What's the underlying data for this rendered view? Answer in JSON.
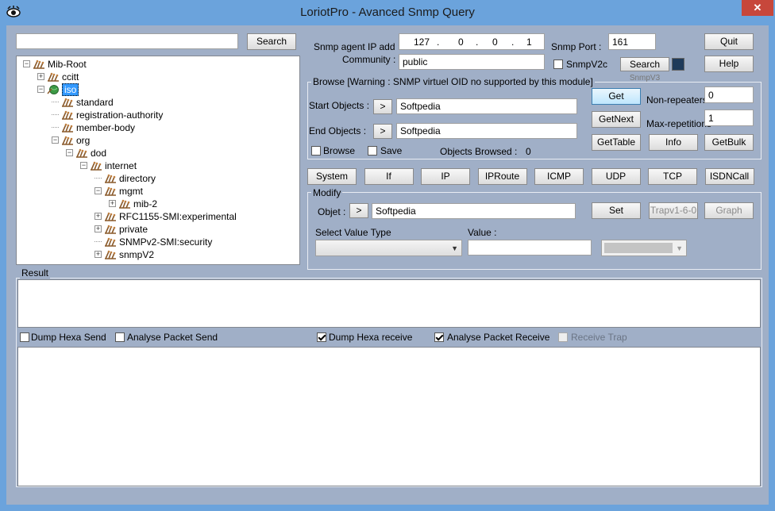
{
  "window": {
    "title": "LoriotPro - Avanced Snmp Query",
    "close": "✕"
  },
  "left": {
    "search_value": "",
    "search_button": "Search"
  },
  "tree": [
    {
      "label": "Mib-Root",
      "expander": "−",
      "depth": 0,
      "selected": false
    },
    {
      "label": "ccitt",
      "expander": "+",
      "depth": 1,
      "selected": false
    },
    {
      "label": "iso",
      "expander": "−",
      "depth": 1,
      "selected": true
    },
    {
      "label": "standard",
      "expander": "",
      "depth": 2,
      "selected": false
    },
    {
      "label": "registration-authority",
      "expander": "",
      "depth": 2,
      "selected": false
    },
    {
      "label": "member-body",
      "expander": "",
      "depth": 2,
      "selected": false
    },
    {
      "label": "org",
      "expander": "−",
      "depth": 2,
      "selected": false
    },
    {
      "label": "dod",
      "expander": "−",
      "depth": 3,
      "selected": false
    },
    {
      "label": "internet",
      "expander": "−",
      "depth": 4,
      "selected": false
    },
    {
      "label": "directory",
      "expander": "",
      "depth": 5,
      "selected": false
    },
    {
      "label": "mgmt",
      "expander": "−",
      "depth": 5,
      "selected": false
    },
    {
      "label": "mib-2",
      "expander": "+",
      "depth": 6,
      "selected": false
    },
    {
      "label": "RFC1155-SMI:experimental",
      "expander": "+",
      "depth": 5,
      "selected": false
    },
    {
      "label": "private",
      "expander": "+",
      "depth": 5,
      "selected": false
    },
    {
      "label": "SNMPv2-SMI:security",
      "expander": "",
      "depth": 5,
      "selected": false
    },
    {
      "label": "snmpV2",
      "expander": "+",
      "depth": 5,
      "selected": false
    }
  ],
  "agent": {
    "ip_label": "Snmp agent IP add :",
    "ip": [
      "127",
      "0",
      "0",
      "1"
    ],
    "ip_dot": ".",
    "community_label": "Community :",
    "community": "public",
    "port_label": "Snmp Port :",
    "port": "161",
    "snmpv2c_label": "SnmpV2c",
    "snmpv2c_checked": false,
    "search_button": "Search",
    "v3_label": "SnmpV3"
  },
  "buttons": {
    "quit": "Quit",
    "help": "Help"
  },
  "browse": {
    "title": "Browse [Warning : SNMP virtuel OID no supported by this module]",
    "start_label": "Start  Objects :",
    "start_value": "Softpedia",
    "end_label": "End  Objects :",
    "end_value": "Softpedia",
    "arrow": ">",
    "browse_label": "Browse",
    "save_label": "Save",
    "objects_browsed_label": "Objects Browsed :",
    "objects_browsed": "0",
    "get": "Get",
    "getnext": "GetNext",
    "gettable": "GetTable",
    "info": "Info",
    "getbulk": "GetBulk",
    "nonrep_label": "Non-repeaters",
    "nonrep_value": "0",
    "maxrep_label": "Max-repetitions",
    "maxrep_value": "1"
  },
  "groups": [
    "System",
    "If",
    "IP",
    "IPRoute",
    "ICMP",
    "UDP",
    "TCP",
    "ISDNCall"
  ],
  "modify": {
    "title": "Modify",
    "objet_label": "Objet :",
    "objet_value": "Softpedia",
    "arrow": ">",
    "set": "Set",
    "trap": "Trapv1-6-0",
    "graph": "Graph",
    "value_type_label": "Select Value Type",
    "value_label": "Value :",
    "value": ""
  },
  "result": {
    "title": "Result",
    "dump_hexa_send": "Dump Hexa Send",
    "analyse_packet_send": "Analyse Packet Send",
    "dump_hexa_receive": "Dump Hexa receive",
    "analyse_packet_receive": "Analyse Packet Receive",
    "receive_trap": "Receive Trap"
  },
  "colors": {
    "titlebar": "#6ba3dc",
    "client": "#a0afc7",
    "selection": "#3399ff",
    "close": "#c7473b"
  }
}
